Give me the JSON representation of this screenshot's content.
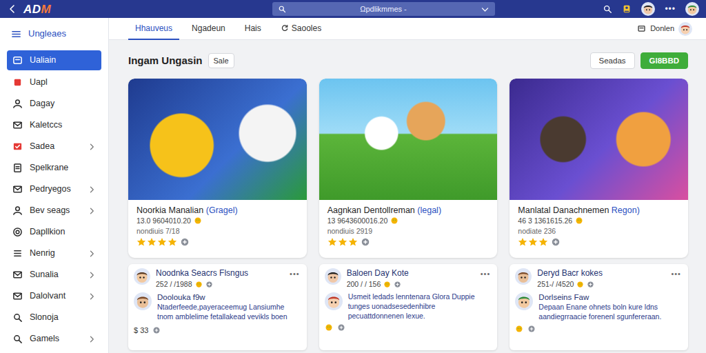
{
  "topbar": {
    "logo_main": "AD",
    "logo_accent": "M",
    "search": {
      "placeholder": "Ωpdlikmmes -"
    },
    "more": "•••"
  },
  "sidebar": {
    "title": "Ungleaes",
    "items": [
      {
        "label": "Ualiain",
        "selected": true,
        "expandable": false
      },
      {
        "label": "Uapl",
        "selected": false,
        "expandable": false
      },
      {
        "label": "Dagay",
        "selected": false,
        "expandable": false
      },
      {
        "label": "Kaletccs",
        "selected": false,
        "expandable": false
      },
      {
        "label": "Sadea",
        "selected": false,
        "expandable": true
      },
      {
        "label": "Spelkrane",
        "selected": false,
        "expandable": false
      },
      {
        "label": "Pedryegos",
        "selected": false,
        "expandable": true
      },
      {
        "label": "Bev seags",
        "selected": false,
        "expandable": true
      },
      {
        "label": "Dapllkion",
        "selected": false,
        "expandable": false
      },
      {
        "label": "Nenrig",
        "selected": false,
        "expandable": true
      },
      {
        "label": "Sunalia",
        "selected": false,
        "expandable": true
      },
      {
        "label": "Dalolvant",
        "selected": false,
        "expandable": true
      },
      {
        "label": "Slonoja",
        "selected": false,
        "expandable": false
      },
      {
        "label": "Gamels",
        "selected": false,
        "expandable": true
      }
    ]
  },
  "tabs": [
    {
      "label": "Hhauveus",
      "selected": true
    },
    {
      "label": "Ngadeun",
      "selected": false
    },
    {
      "label": "Hais",
      "selected": false
    },
    {
      "label": "Saooles",
      "selected": false
    }
  ],
  "account": {
    "label": "Donlen"
  },
  "section": {
    "title": "Ingam Ungasin",
    "badge": "Sale",
    "buttons": [
      {
        "label": "Seadas",
        "kind": "outline"
      },
      {
        "label": "Gl8BBD",
        "kind": "success"
      }
    ]
  },
  "games": [
    {
      "title": "Noorkia Manalian",
      "tag": "(Gragel)",
      "stats": "13.0 9604010.20",
      "note": "nondiuis 7/18",
      "stars": 4
    },
    {
      "title": "Aagnkan Dentollreman",
      "tag": "(legal)",
      "stats": "13 9643600016.20",
      "note": "nondiuis 2919",
      "stars": 3
    },
    {
      "title": "Manlatal Danachnemen",
      "tag": "Regon)",
      "stats": "46 3 1361615.26",
      "note": "nodiate 236",
      "stars": 3
    }
  ],
  "posts": [
    {
      "title": "Noodnka Seacrs Flsngus",
      "meta": "252 / /1988",
      "menu": "•••",
      "author": "Doolouka f9w",
      "body": "Ntaderfeede,payeraceemug Lansiumhe tnom amblelime fetallakead vevikls boen",
      "price": "$ 33"
    },
    {
      "title": "Baloen Day Kote",
      "meta": "200 / / 156",
      "menu": "•••",
      "body": "Usmeit ledads lenntenara Glora Duppie tunges uonadsesedenhibre pecuattdonnenen lexue."
    },
    {
      "title": "Deryd Bacr kokes",
      "meta": "251-/ /4520",
      "menu": "•••",
      "author": "Dorlseins Faw",
      "body": "Depaan Enane ohnets boln kure ldns aandiegrraacie forenenl sgunfereraan."
    }
  ]
}
